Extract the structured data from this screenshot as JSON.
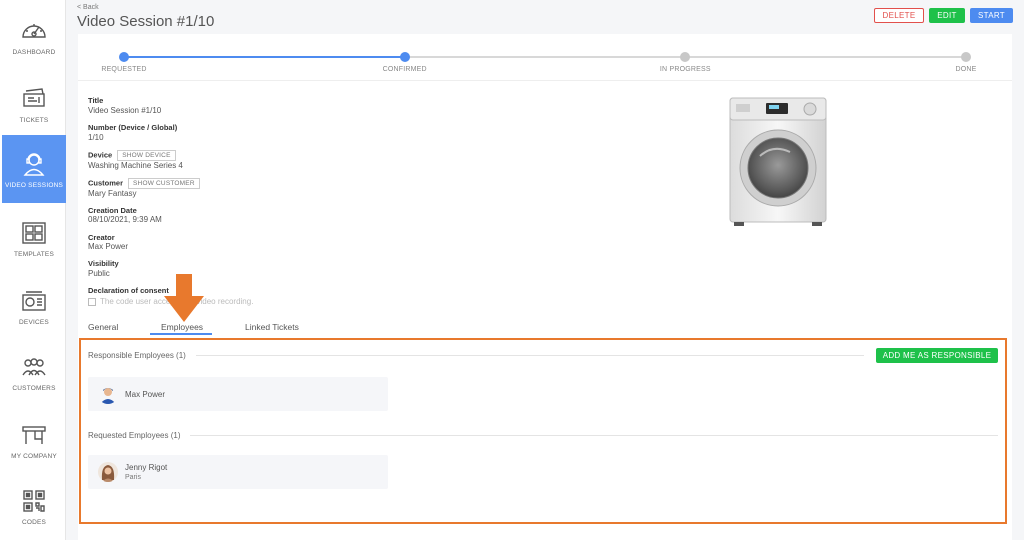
{
  "sidebar": {
    "items": [
      {
        "label": "DASHBOARD",
        "icon": "dashboard-icon"
      },
      {
        "label": "TICKETS",
        "icon": "ticket-icon"
      },
      {
        "label": "VIDEO SESSIONS",
        "icon": "video-session-icon",
        "active": true
      },
      {
        "label": "TEMPLATES",
        "icon": "templates-icon"
      },
      {
        "label": "DEVICES",
        "icon": "devices-icon"
      },
      {
        "label": "CUSTOMERS",
        "icon": "customers-icon"
      },
      {
        "label": "MY COMPANY",
        "icon": "company-icon"
      },
      {
        "label": "CODES",
        "icon": "qr-code-icon"
      }
    ]
  },
  "header": {
    "back": "< Back",
    "title": "Video Session #1/10",
    "actions": {
      "delete": "DELETE",
      "edit": "EDIT",
      "start": "START"
    }
  },
  "progress": {
    "steps": [
      "REQUESTED",
      "CONFIRMED",
      "IN PROGRESS",
      "DONE"
    ],
    "completed": 2
  },
  "details": {
    "title_label": "Title",
    "title_value": "Video Session #1/10",
    "number_label": "Number (Device / Global)",
    "number_value": "1/10",
    "device_label": "Device",
    "device_button": "SHOW DEVICE",
    "device_value": "Washing Machine Series 4",
    "customer_label": "Customer",
    "customer_button": "SHOW CUSTOMER",
    "customer_value": "Mary Fantasy",
    "creation_label": "Creation Date",
    "creation_value": "08/10/2021, 9:39 AM",
    "creator_label": "Creator",
    "creator_value": "Max Power",
    "visibility_label": "Visibility",
    "visibility_value": "Public",
    "consent_label": "Declaration of consent",
    "consent_text": "The code user accepts the video recording."
  },
  "tabs": {
    "items": [
      "General",
      "Employees",
      "Linked Tickets"
    ],
    "active": "Employees"
  },
  "employees": {
    "responsible_title": "Responsible Employees (1)",
    "add_button": "ADD ME AS RESPONSIBLE",
    "responsible": [
      {
        "name": "Max Power"
      }
    ],
    "requested_title": "Requested Employees (1)",
    "requested": [
      {
        "name": "Jenny Rigot",
        "city": "Paris"
      }
    ]
  },
  "colors": {
    "accent": "#4d8bf0",
    "success": "#1ec14a",
    "danger": "#e2504c",
    "highlight": "#e8792d"
  }
}
